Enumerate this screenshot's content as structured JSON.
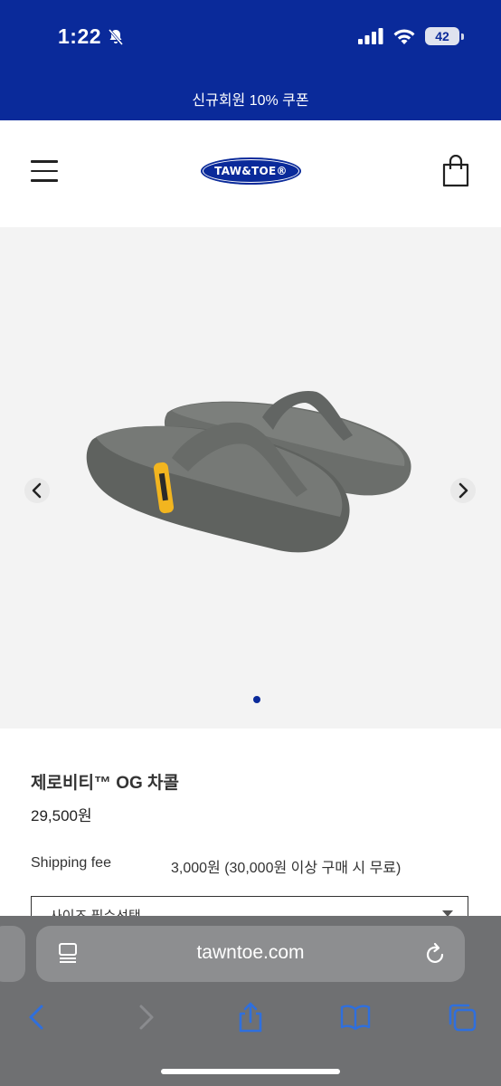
{
  "status_bar": {
    "time": "1:22",
    "battery": "42",
    "signal_icon": "signal-bars-icon",
    "wifi_icon": "wifi-icon",
    "silent_icon": "bell-slash-icon"
  },
  "promo": {
    "text": "신규회원 10% 쿠폰"
  },
  "header": {
    "logo_text": "TAW&TOE®",
    "menu_icon": "hamburger-menu-icon",
    "cart_icon": "shopping-bag-icon"
  },
  "gallery": {
    "slide_count": 1,
    "current_slide": 1,
    "prev_icon": "chevron-left-icon",
    "next_icon": "chevron-right-icon"
  },
  "product": {
    "title": "제로비티™ OG 차콜",
    "price": "29,500원",
    "shipping_label": "Shipping fee",
    "shipping_value": "3,000원 (30,000원 이상 구매 시 무료)",
    "size_select_text": "사이즈 필수선택"
  },
  "browser": {
    "url": "tawntoe.com",
    "reader_icon": "reader-mode-icon",
    "reload_icon": "reload-icon",
    "back_icon": "back-arrow-icon",
    "forward_icon": "forward-arrow-icon",
    "share_icon": "share-icon",
    "bookmarks_icon": "book-icon",
    "tabs_icon": "tabs-icon"
  },
  "colors": {
    "brand": "#0a2a9a",
    "gallery_bg": "#f3f3f3",
    "browser_toolbar": "#6f7072",
    "browser_accent": "#2f6fdd",
    "strap_yellow": "#f2b51f",
    "sandal_gray": "#6b6e6b"
  }
}
